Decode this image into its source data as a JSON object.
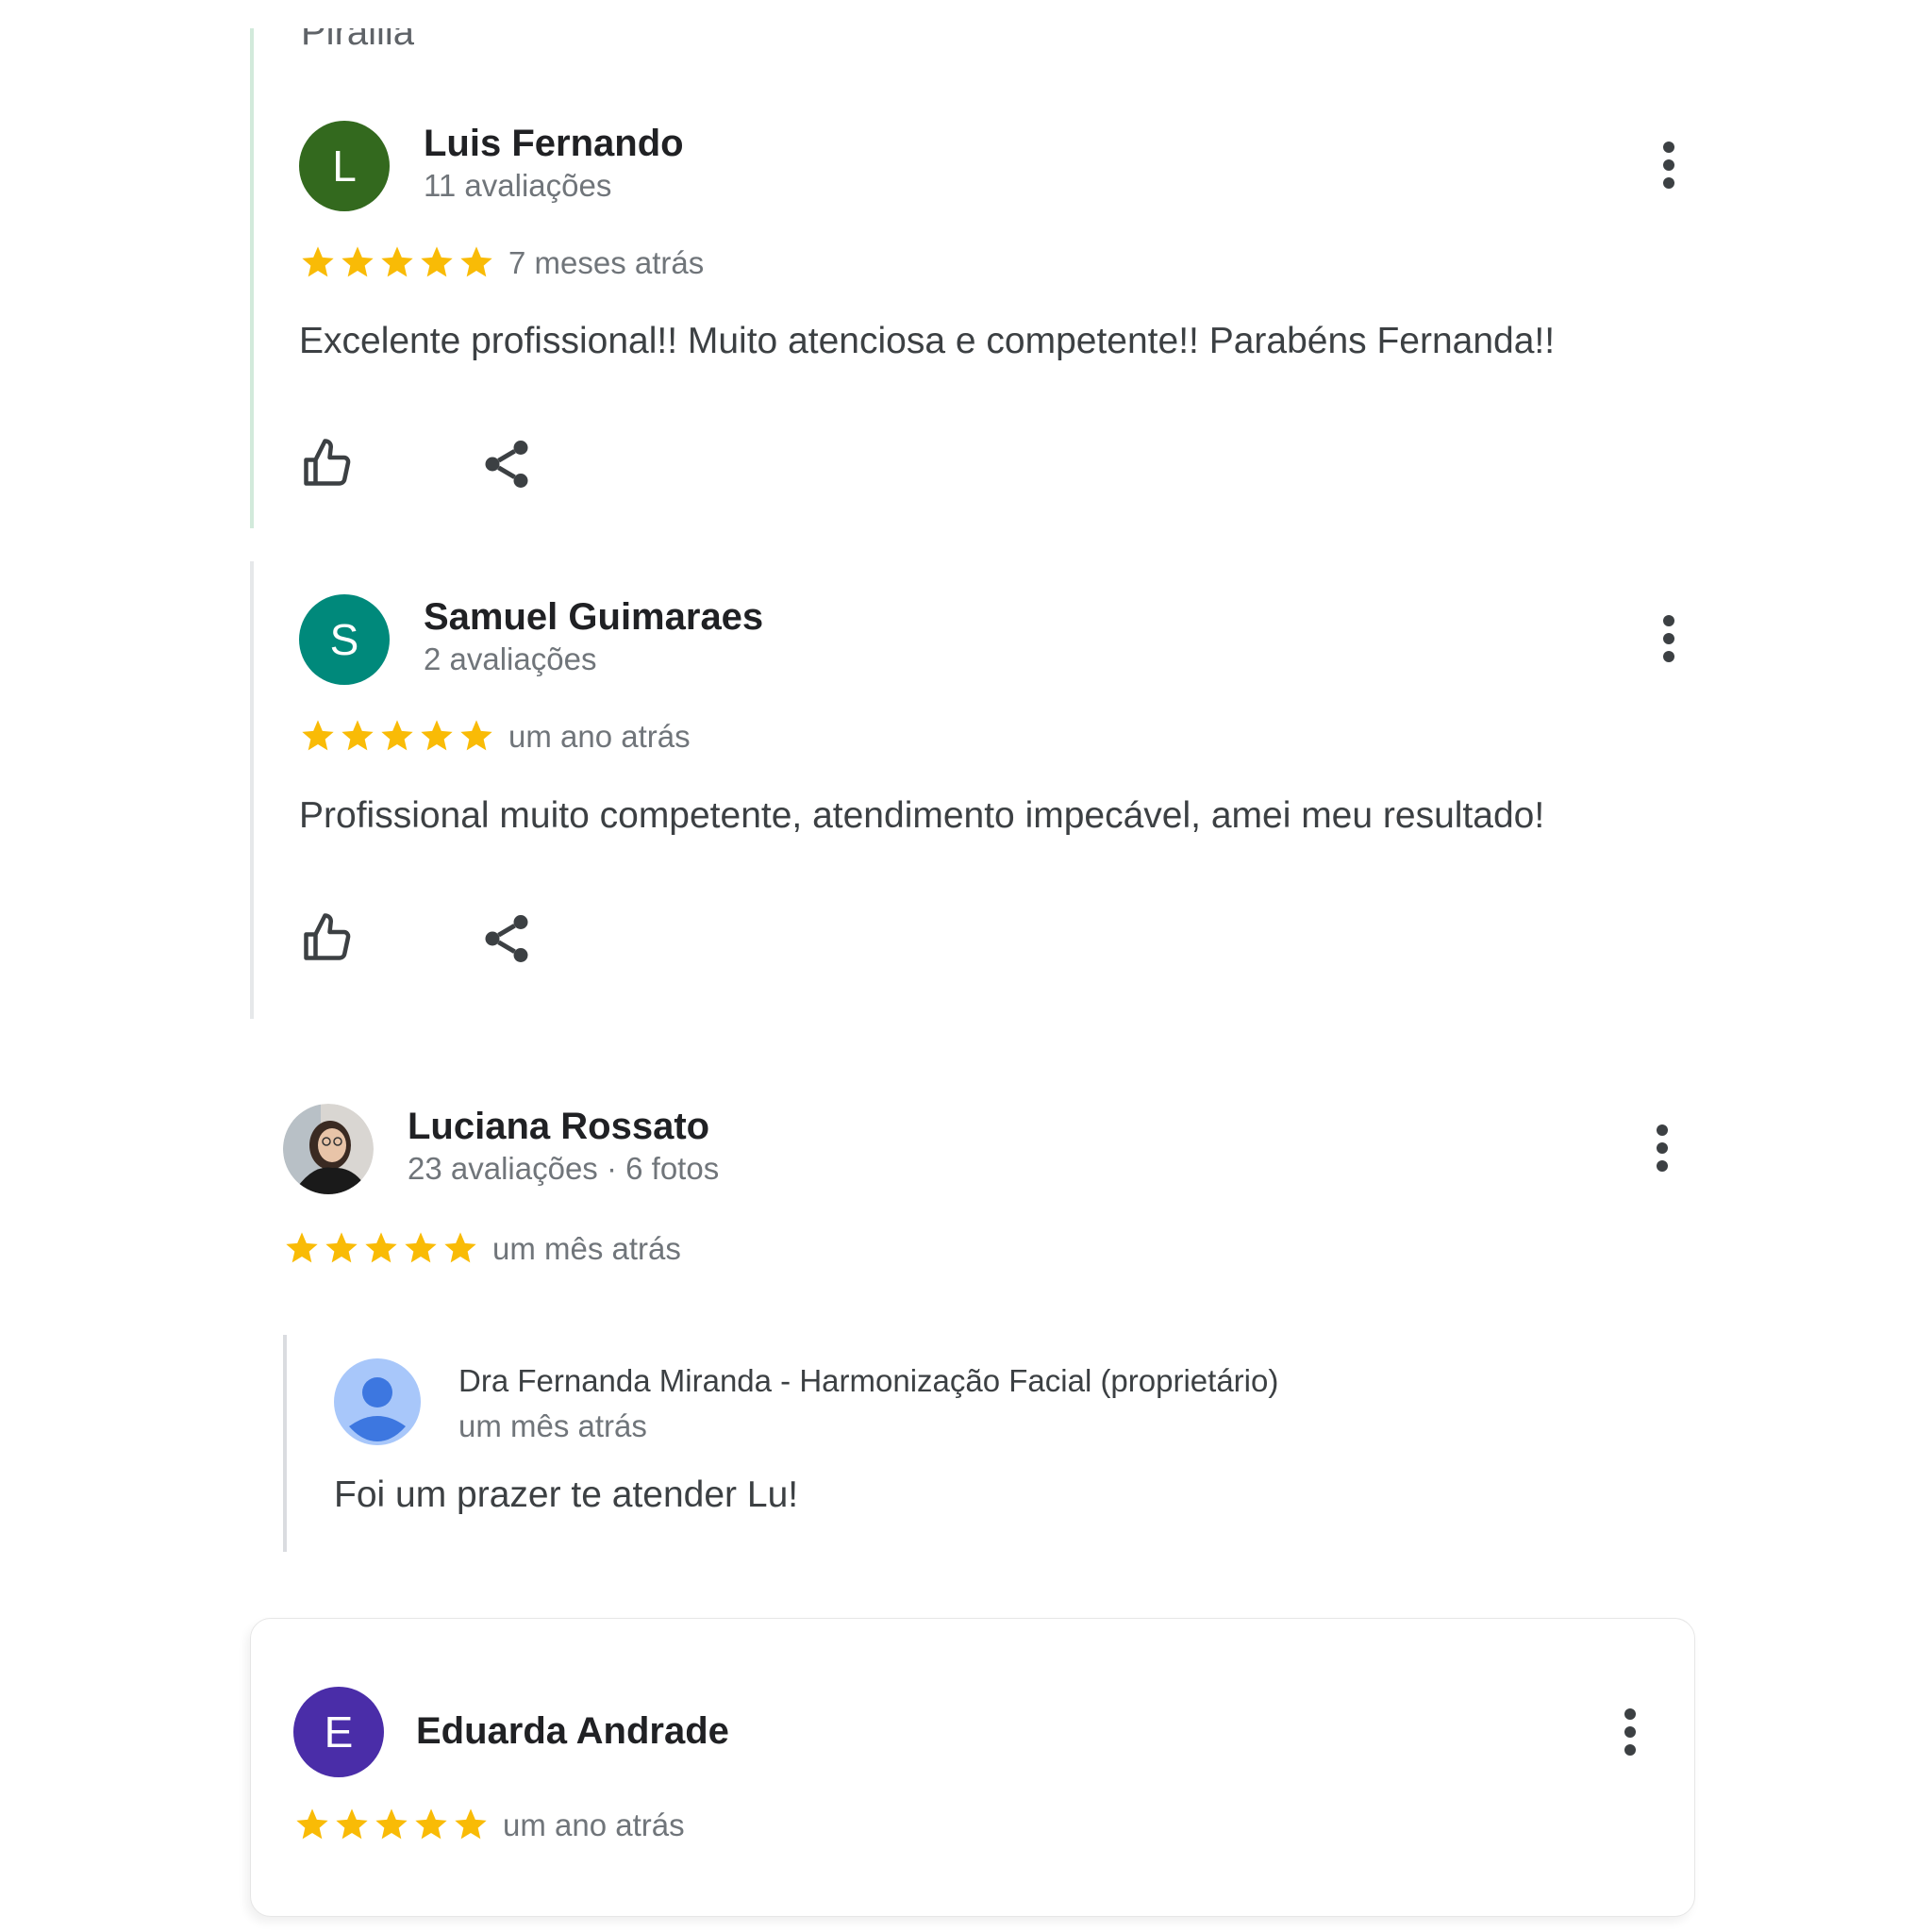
{
  "colors": {
    "star": "#f9bb06",
    "avatar_l": "#33691e",
    "avatar_s": "#00897b",
    "avatar_e": "#4a2da8"
  },
  "top_cutoff_text": "Pirallia",
  "reviews": [
    {
      "initial": "L",
      "name": "Luis Fernando",
      "meta": "11 avaliações",
      "stars": 5,
      "when": "7 meses atrás",
      "text": "Excelente profissional!! Muito atenciosa e competente!! Parabéns Fernanda!!"
    },
    {
      "initial": "S",
      "name": "Samuel Guimaraes",
      "meta": "2 avaliações",
      "stars": 5,
      "when": "um ano atrás",
      "text": "Profissional muito competente, atendimento impecável, amei meu resultado!"
    },
    {
      "name": "Luciana Rossato",
      "meta": "23 avaliações · 6 fotos",
      "stars": 5,
      "when": "um mês atrás",
      "reply": {
        "owner": "Dra Fernanda Miranda - Harmonização Facial (proprietário)",
        "when": "um mês atrás",
        "text": "Foi um prazer te atender Lu!"
      }
    },
    {
      "initial": "E",
      "name": "Eduarda Andrade",
      "stars": 5,
      "when": "um ano atrás"
    }
  ]
}
